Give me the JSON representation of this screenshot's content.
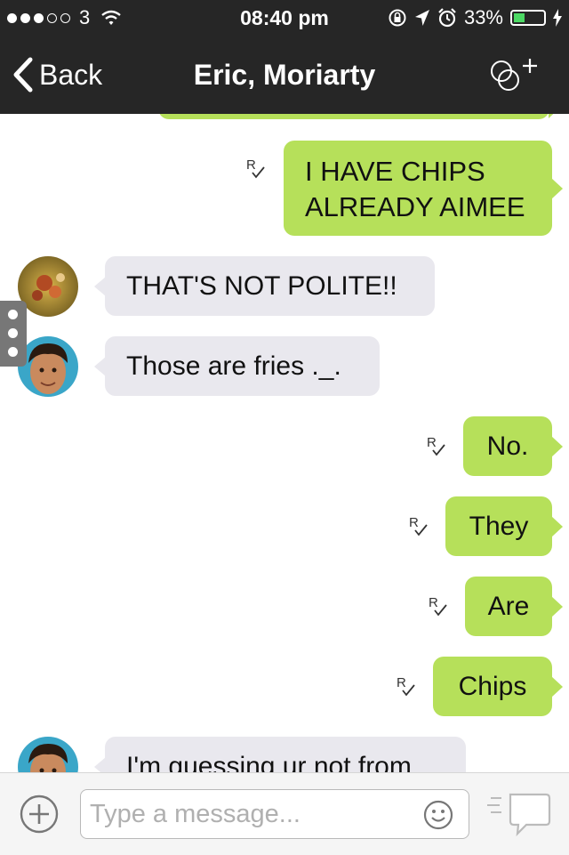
{
  "status_bar": {
    "carrier": "3",
    "time": "08:40 pm",
    "battery": "33%",
    "battery_level": 0.33
  },
  "nav": {
    "back_label": "Back",
    "title": "Eric, Moriarty",
    "group_action_icon": "add-participant-icon"
  },
  "messages": [
    {
      "direction": "out",
      "text_line1": "I HAVE CHIPS",
      "text_line2": "ALREADY AIMEE",
      "receipt": "R✓"
    },
    {
      "direction": "in",
      "sender_avatar": "flower-avatar",
      "text": "THAT'S NOT POLITE!!"
    },
    {
      "direction": "in",
      "sender_avatar": "boy-avatar",
      "text": "Those are fries ._."
    },
    {
      "direction": "out",
      "text": "No.",
      "receipt": "R✓"
    },
    {
      "direction": "out",
      "text": "They",
      "receipt": "R✓"
    },
    {
      "direction": "out",
      "text": "Are",
      "receipt": "R✓"
    },
    {
      "direction": "out",
      "text": "Chips",
      "receipt": "R✓"
    },
    {
      "direction": "in",
      "sender_avatar": "boy-avatar",
      "text": "I'm guessing ur not from"
    }
  ],
  "composer": {
    "placeholder": "Type a message...",
    "value": ""
  },
  "colors": {
    "bar_background": "#262626",
    "outgoing_bubble": "#b6e05a",
    "incoming_bubble": "#e9e8ee"
  }
}
